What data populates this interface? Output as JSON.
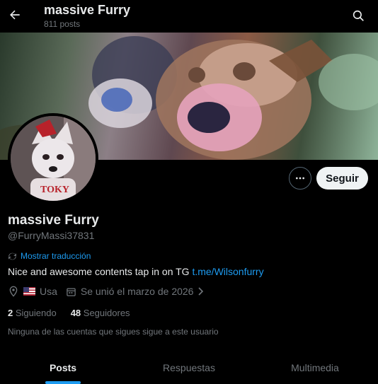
{
  "header": {
    "title": "massive Furry",
    "posts_count": "811 posts",
    "back_icon": "arrow-left-icon",
    "search_icon": "search-icon"
  },
  "profile": {
    "name": "massive Furry",
    "handle": "@FurryMassi37831",
    "translate_label": "Mostrar traducción",
    "bio_text": "Nice and awesome contents tap in on TG ",
    "bio_link": "t.me/Wilsonfurry",
    "location": "Usa",
    "joined": "Se unió el marzo de 2026",
    "following_count": "2",
    "following_label": "Siguiendo",
    "followers_count": "48",
    "followers_label": "Seguidores",
    "no_mutuals": "Ninguna de las cuentas que sigues sigue a este usuario"
  },
  "actions": {
    "follow_label": "Seguir",
    "more_icon": "more-horizontal-icon"
  },
  "tabs": [
    {
      "label": "Posts",
      "active": true
    },
    {
      "label": "Respuestas",
      "active": false
    },
    {
      "label": "Multimedia",
      "active": false
    }
  ],
  "colors": {
    "accent": "#1d9bf0",
    "background": "#000000",
    "text": "#e7e9ea",
    "muted": "#71767b"
  }
}
